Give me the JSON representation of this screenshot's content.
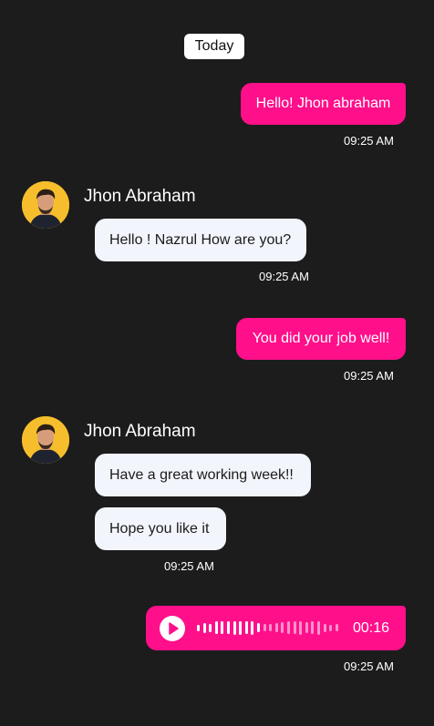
{
  "date_separator": "Today",
  "colors": {
    "background": "#1c1c1c",
    "outgoing_bubble": "#ff0f8a",
    "incoming_bubble": "#f2f5fb",
    "avatar_bg": "#f6be2c"
  },
  "messages": {
    "m1": {
      "text": "Hello! Jhon abraham",
      "time": "09:25 AM",
      "direction": "outgoing"
    },
    "g1": {
      "sender": "Jhon Abraham",
      "avatar_icon": "user-avatar",
      "bubbles": [
        "Hello ! Nazrul How are you?"
      ],
      "time": "09:25 AM"
    },
    "m2": {
      "text": "You did your job well!",
      "time": "09:25 AM",
      "direction": "outgoing"
    },
    "g2": {
      "sender": "Jhon Abraham",
      "avatar_icon": "user-avatar",
      "bubbles": [
        "Have a great working week!!",
        "Hope you like it"
      ],
      "time": "09:25 AM"
    },
    "voice": {
      "duration": "00:16",
      "time": "09:25 AM",
      "play_icon": "play-icon",
      "waveform_levels": [
        0.4,
        0.6,
        0.5,
        0.75,
        0.75,
        0.75,
        0.85,
        0.85,
        0.75,
        0.85,
        0.55,
        0.45,
        0.45,
        0.55,
        0.65,
        0.75,
        0.8,
        0.85,
        0.65,
        0.75,
        0.85,
        0.5,
        0.4,
        0.45
      ],
      "waveform_played": 11
    }
  }
}
